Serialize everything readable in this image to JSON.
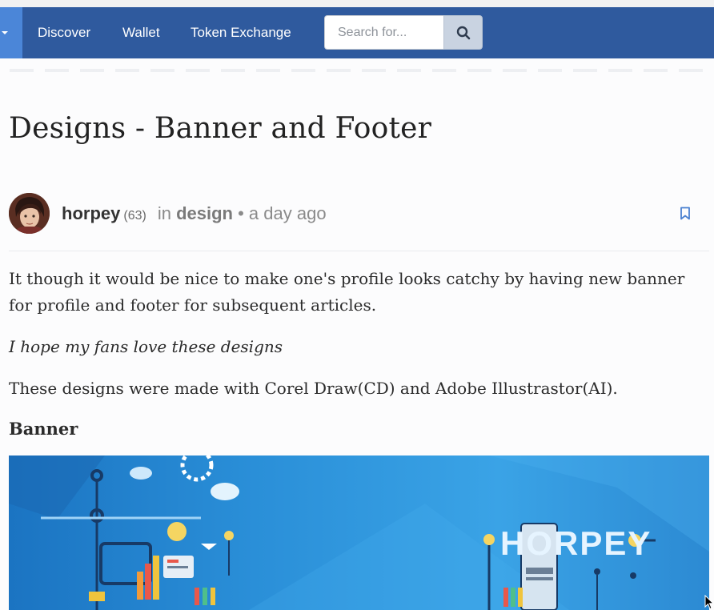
{
  "nav": {
    "links": [
      "Discover",
      "Wallet",
      "Token Exchange"
    ],
    "search_placeholder": "Search for..."
  },
  "post": {
    "title": "Designs - Banner and Footer",
    "author": "horpey",
    "reputation": "(63)",
    "in_text": "in",
    "category": "design",
    "separator": "•",
    "time": "a day ago",
    "paragraphs": [
      "It though it would be nice to make one's profile looks catchy by having new banner for profile and footer for subsequent articles.",
      "I hope my fans love these designs",
      "These designs were made with Corel Draw(CD) and Adobe Illustrastor(AI)."
    ],
    "section_heading": "Banner",
    "banner_logo_text": "HORPEY"
  },
  "colors": {
    "nav_bg": "#2f5a9e",
    "menu_button_bg": "#4b86d8",
    "bookmark_icon": "#4a80d0",
    "banner_blue": "#2a8fd8"
  },
  "icons": {
    "menu_caret": "caret-down-icon",
    "search": "search-icon",
    "bookmark": "bookmark-icon",
    "cursor": "mouse-cursor-icon"
  }
}
